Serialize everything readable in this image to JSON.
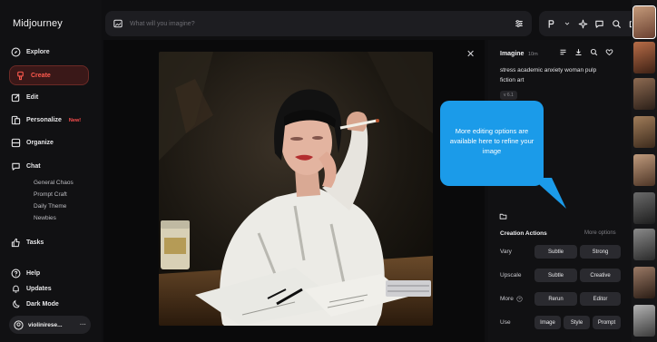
{
  "app": {
    "title": "Midjourney"
  },
  "sidebar": {
    "items": [
      {
        "label": "Explore",
        "icon": "compass-icon"
      },
      {
        "label": "Create",
        "icon": "brush-icon"
      },
      {
        "label": "Edit",
        "icon": "edit-icon"
      },
      {
        "label": "Personalize",
        "icon": "personalize-icon",
        "badge": "New!"
      },
      {
        "label": "Organize",
        "icon": "organize-icon"
      },
      {
        "label": "Chat",
        "icon": "chat-icon"
      },
      {
        "label": "Tasks",
        "icon": "thumbs-up-icon"
      },
      {
        "label": "Help",
        "icon": "help-icon"
      },
      {
        "label": "Updates",
        "icon": "bell-icon"
      },
      {
        "label": "Dark Mode",
        "icon": "moon-icon"
      }
    ],
    "chat_rooms": [
      "General Chaos",
      "Prompt Craft",
      "Daily Theme",
      "Newbies"
    ],
    "user": {
      "name": "violinirese...",
      "more": "···"
    }
  },
  "search": {
    "placeholder": "What will you imagine?"
  },
  "toolbar": {
    "icons": [
      "p-icon",
      "chevron-down-icon",
      "sparkle-icon",
      "chat-icon",
      "search-icon",
      "folder-icon"
    ]
  },
  "viewer": {
    "close": "✕"
  },
  "panel": {
    "title": "Imagine",
    "time": "10m",
    "prompt": "stress academic anxiety woman pulp fiction art",
    "version": "v 6.1",
    "creation_actions": {
      "title": "Creation Actions",
      "more_options": "More options",
      "rows": [
        {
          "label": "Vary",
          "buttons": [
            "Subtle",
            "Strong"
          ]
        },
        {
          "label": "Upscale",
          "buttons": [
            "Subtle",
            "Creative"
          ]
        },
        {
          "label": "More",
          "buttons": [
            "Rerun",
            "Editor"
          ]
        },
        {
          "label": "Use",
          "buttons": [
            "Image",
            "Style",
            "Prompt"
          ]
        }
      ]
    }
  },
  "callout": {
    "text": "More editing options are available here to refine your image",
    "color": "#1b9be9"
  },
  "colors": {
    "accent": "#ff5a4e",
    "background": "#0f0f11"
  }
}
